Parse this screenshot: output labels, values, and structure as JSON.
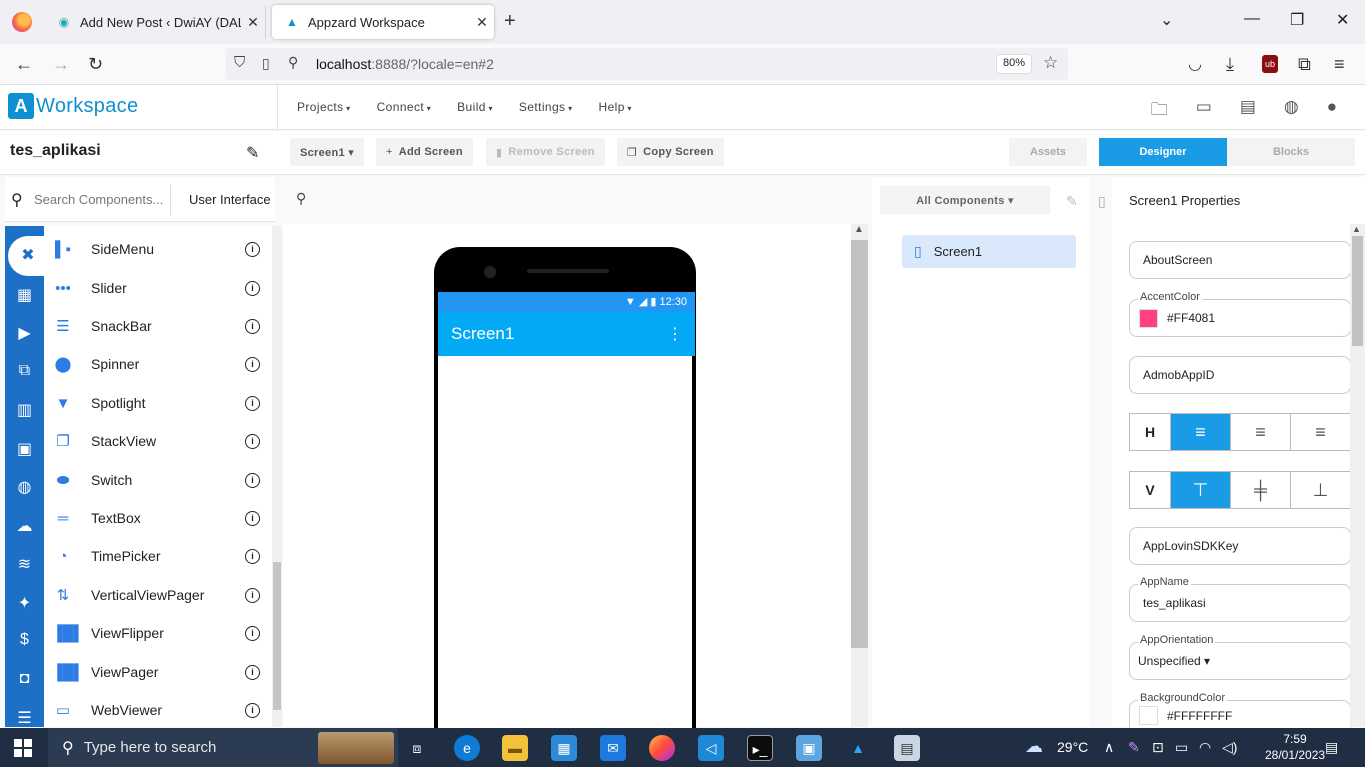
{
  "browser": {
    "tabs": [
      {
        "title": "Add New Post ‹ DwiAY (DAL180",
        "close": "✕"
      },
      {
        "title": "Appzard Workspace",
        "close": "✕"
      }
    ],
    "new_tab": "+",
    "url_host": "localhost",
    "url_rest": ":8888/?locale=en#2",
    "zoom": "80%"
  },
  "app": {
    "logo_letter": "A",
    "logo_word": "Workspace",
    "menus": [
      "Projects",
      "Connect",
      "Build",
      "Settings",
      "Help"
    ],
    "project_name": "tes_aplikasi",
    "screen_select": "Screen1 ▾",
    "add_screen": "Add Screen",
    "remove_screen": "Remove Screen",
    "copy_screen": "Copy Screen",
    "assets": "Assets",
    "designer": "Designer",
    "blocks": "Blocks",
    "accent": "#1a9be6"
  },
  "palette": {
    "search_placeholder": "Search Components...",
    "category": "User Interface",
    "items": [
      {
        "label": "SideMenu",
        "icon": "side-menu-icon"
      },
      {
        "label": "Slider",
        "icon": "slider-icon"
      },
      {
        "label": "SnackBar",
        "icon": "snackbar-icon"
      },
      {
        "label": "Spinner",
        "icon": "spinner-icon"
      },
      {
        "label": "Spotlight",
        "icon": "spotlight-icon"
      },
      {
        "label": "StackView",
        "icon": "stackview-icon"
      },
      {
        "label": "Switch",
        "icon": "switch-icon"
      },
      {
        "label": "TextBox",
        "icon": "textbox-icon"
      },
      {
        "label": "TimePicker",
        "icon": "timepicker-icon"
      },
      {
        "label": "VerticalViewPager",
        "icon": "vertical-viewpager-icon"
      },
      {
        "label": "ViewFlipper",
        "icon": "viewflipper-icon"
      },
      {
        "label": "ViewPager",
        "icon": "viewpager-icon"
      },
      {
        "label": "WebViewer",
        "icon": "webviewer-icon"
      }
    ]
  },
  "phone": {
    "time": "12:30",
    "title": "Screen1",
    "statusbar_color": "#2196f3",
    "appbar_color": "#03a9f4"
  },
  "components": {
    "filter": "All Components ▾",
    "tree": [
      "Screen1"
    ]
  },
  "properties": {
    "header": "Screen1 Properties",
    "about_screen": "AboutScreen",
    "accent_label": "AccentColor",
    "accent_value": "#FF4081",
    "accent_color": "#ff4081",
    "admob": "AdmobAppID",
    "h_label": "H",
    "v_label": "V",
    "applovin": "AppLovinSDKKey",
    "appname_label": "AppName",
    "appname_value": "tes_aplikasi",
    "orientation_label": "AppOrientation",
    "orientation_value": "Unspecified ▾",
    "bg_label": "BackgroundColor",
    "bg_value": "#FFFFFFFF"
  },
  "taskbar": {
    "search_text": "Type here to search",
    "weather": "29°C",
    "time": "7:59",
    "date": "28/01/2023"
  }
}
